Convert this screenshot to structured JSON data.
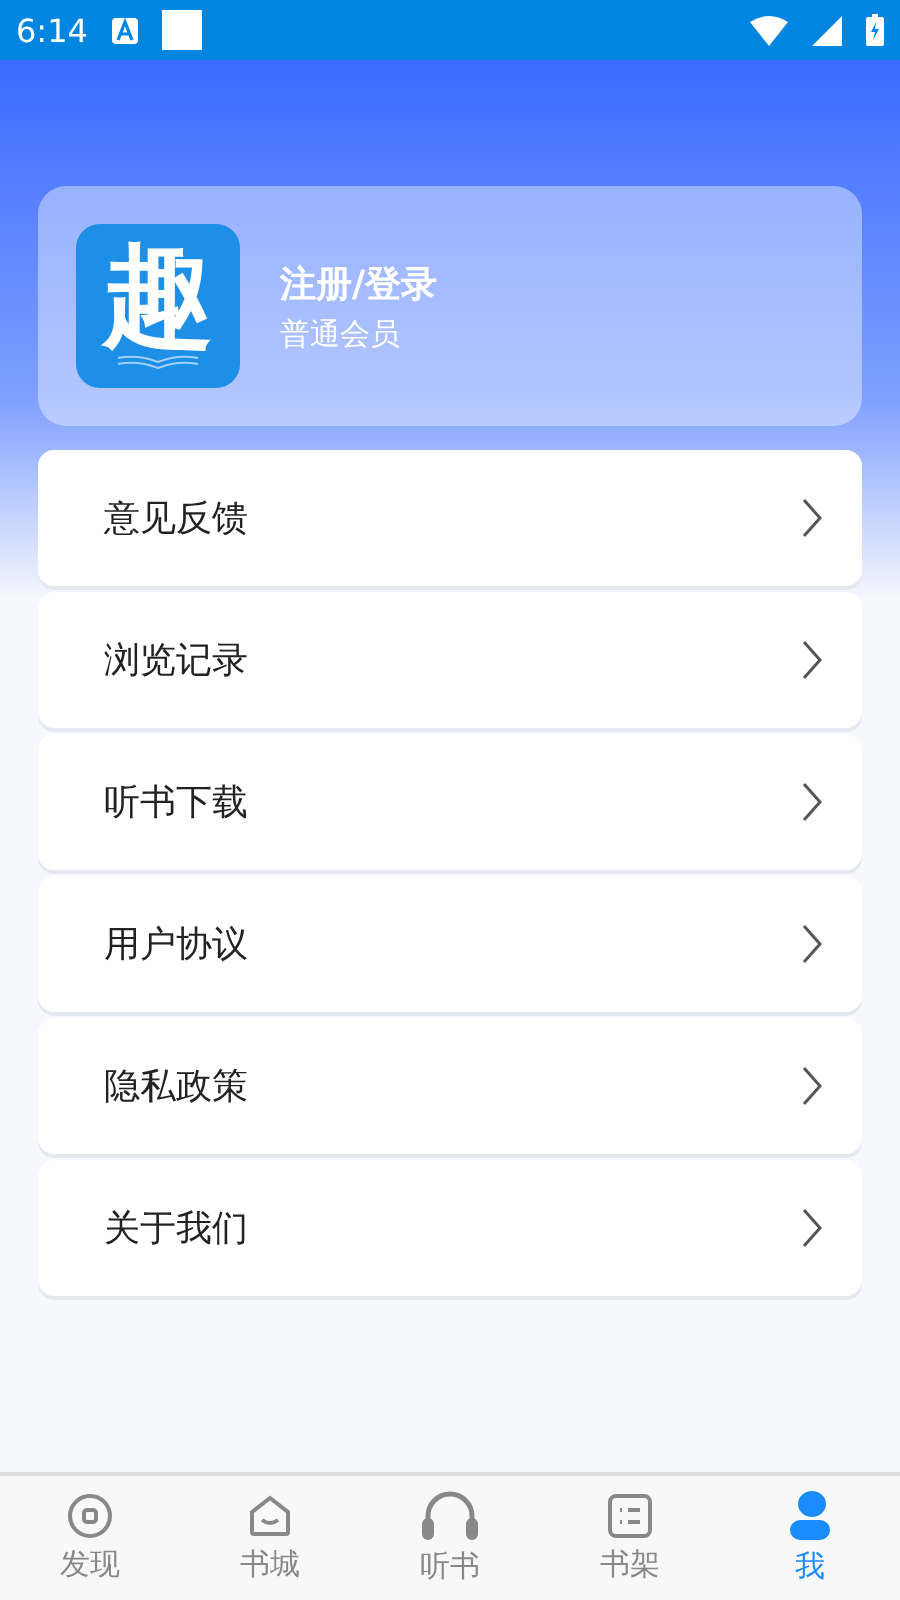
{
  "status_bar": {
    "time": "6:14"
  },
  "profile": {
    "logo_text": "趣",
    "title": "注册/登录",
    "subtitle": "普通会员"
  },
  "menu": [
    {
      "label": "意见反馈"
    },
    {
      "label": "浏览记录"
    },
    {
      "label": "听书下载"
    },
    {
      "label": "用户协议"
    },
    {
      "label": "隐私政策"
    },
    {
      "label": "关于我们"
    }
  ],
  "nav": [
    {
      "label": "发现",
      "selected": false
    },
    {
      "label": "书城",
      "selected": false
    },
    {
      "label": "听书",
      "selected": false
    },
    {
      "label": "书架",
      "selected": false
    },
    {
      "label": "我",
      "selected": true
    }
  ]
}
